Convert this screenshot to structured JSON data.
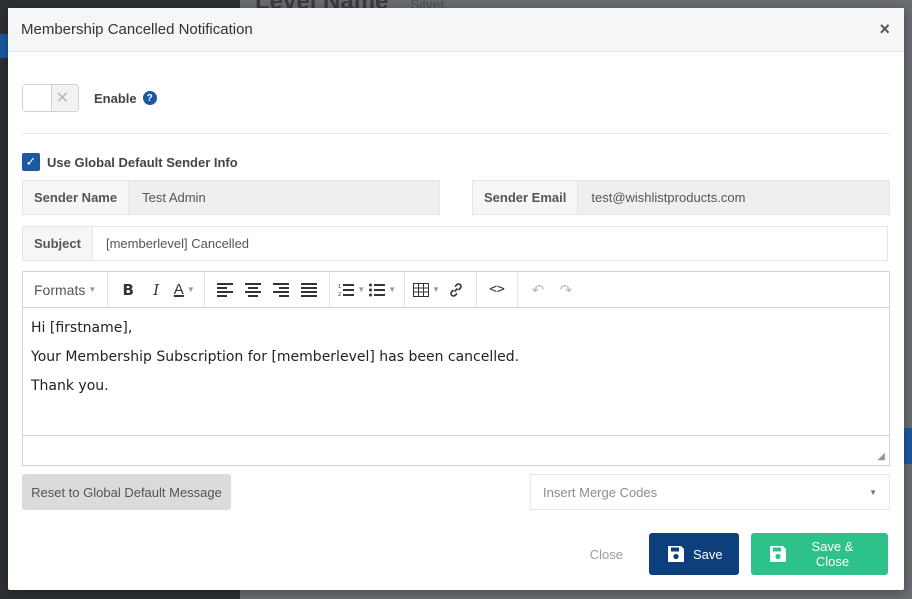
{
  "background": {
    "title": "Level Name",
    "level_value": "Silver"
  },
  "modal": {
    "title": "Membership Cancelled Notification",
    "close_icon": "×"
  },
  "enable": {
    "label": "Enable",
    "toggle_state": "off",
    "help_icon": "?"
  },
  "sender": {
    "use_global_label": "Use Global Default Sender Info",
    "use_global_checked": true,
    "name_label": "Sender Name",
    "name_value": "Test Admin",
    "email_label": "Sender Email",
    "email_value": "test@wishlistproducts.com"
  },
  "subject": {
    "label": "Subject",
    "value": "[memberlevel] Cancelled"
  },
  "editor": {
    "formats_label": "Formats",
    "toolbar_icons": [
      "bold-icon",
      "italic-icon",
      "text-color-icon",
      "align-left-icon",
      "align-center-icon",
      "align-right-icon",
      "align-justify-icon",
      "numbered-list-icon",
      "bullet-list-icon",
      "table-icon",
      "link-icon",
      "code-icon",
      "undo-icon",
      "redo-icon"
    ],
    "lines": [
      "Hi [firstname],",
      "Your Membership Subscription for [memberlevel] has been cancelled.",
      "Thank you."
    ]
  },
  "actions": {
    "reset_label": "Reset to Global Default Message",
    "merge_placeholder": "Insert Merge Codes"
  },
  "footer": {
    "close_label": "Close",
    "save_label": "Save",
    "save_close_label": "Save & Close"
  },
  "colors": {
    "primary": "#0e3f7d",
    "success": "#2cc28a",
    "checkbox": "#1b5aa0"
  }
}
